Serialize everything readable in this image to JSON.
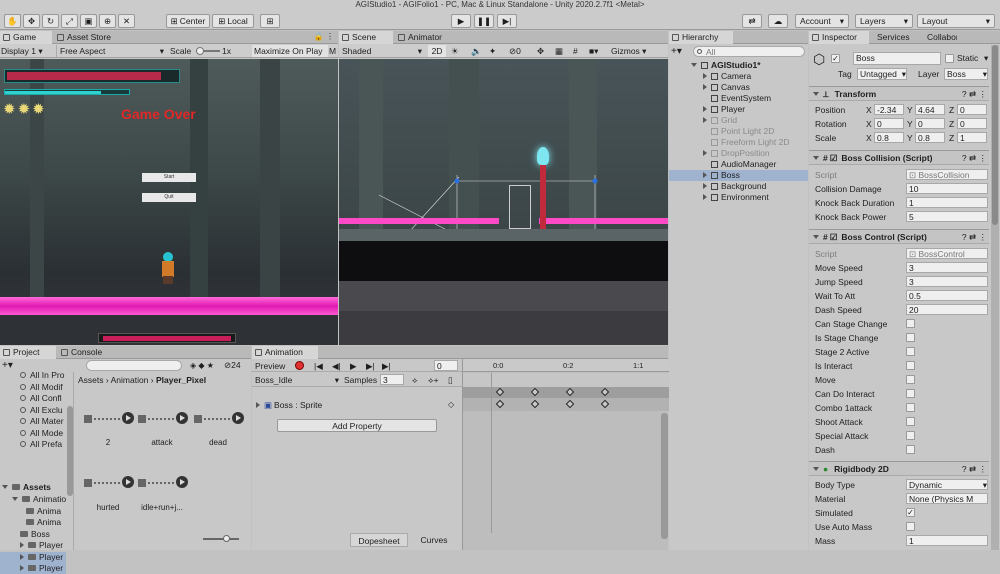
{
  "window_title": "AGIStudio1 - AGIFolio1 - PC, Mac & Linux Standalone - Unity 2020.2.7f1 <Metal>",
  "toolbar": {
    "center_label": "Center",
    "local_label": "Local",
    "account_label": "Account",
    "layers_label": "Layers",
    "layout_label": "Layout"
  },
  "game_panel": {
    "tab_game": "Game",
    "tab_asset_store": "Asset Store",
    "display": "Display 1",
    "aspect": "Free Aspect",
    "scale_label": "Scale",
    "scale_value": "1x",
    "maximize": "Maximize On Play",
    "mute": "M",
    "game_over": "Game Over",
    "start_btn": "Start",
    "quit_btn": "Quit"
  },
  "scene_panel": {
    "tab_scene": "Scene",
    "tab_animator": "Animator",
    "shading": "Shaded",
    "mode_2d": "2D",
    "gizmos": "Gizmos",
    "hidden_count": "0"
  },
  "hierarchy": {
    "tab": "Hierarchy",
    "search_placeholder": "All",
    "root": "AGIStudio1*",
    "items": [
      {
        "label": "Camera",
        "arrow": true,
        "dim": false
      },
      {
        "label": "Canvas",
        "arrow": true,
        "dim": false
      },
      {
        "label": "EventSystem",
        "arrow": false,
        "dim": false
      },
      {
        "label": "Player",
        "arrow": true,
        "dim": false
      },
      {
        "label": "Grid",
        "arrow": true,
        "dim": true
      },
      {
        "label": "Point Light 2D",
        "arrow": false,
        "dim": true
      },
      {
        "label": "Freeform Light 2D",
        "arrow": false,
        "dim": true
      },
      {
        "label": "DropPosition",
        "arrow": true,
        "dim": true
      },
      {
        "label": "AudioManager",
        "arrow": false,
        "dim": false
      },
      {
        "label": "Boss",
        "arrow": true,
        "dim": false
      },
      {
        "label": "Background",
        "arrow": true,
        "dim": false
      },
      {
        "label": "Environment",
        "arrow": true,
        "dim": false
      }
    ]
  },
  "inspector": {
    "tab_inspector": "Inspector",
    "tab_services": "Services",
    "tab_collab": "Collabor",
    "object_name": "Boss",
    "static_label": "Static",
    "tag_label": "Tag",
    "tag_value": "Untagged",
    "layer_label": "Layer",
    "layer_value": "Boss",
    "transform": {
      "title": "Transform",
      "position_label": "Position",
      "rotation_label": "Rotation",
      "scale_label": "Scale",
      "px": "-2.34",
      "py": "4.64",
      "pz": "0",
      "rx": "0",
      "ry": "0",
      "rz": "0",
      "sx": "0.8",
      "sy": "0.8",
      "sz": "1"
    },
    "boss_collision": {
      "title": "Boss Collision (Script)",
      "script_label": "Script",
      "script_value": "BossCollision",
      "fields": [
        {
          "label": "Collision Damage",
          "value": "10"
        },
        {
          "label": "Knock Back Duration",
          "value": "1"
        },
        {
          "label": "Knock Back Power",
          "value": "5"
        }
      ]
    },
    "boss_control": {
      "title": "Boss Control (Script)",
      "script_label": "Script",
      "script_value": "BossControl",
      "fields": [
        {
          "label": "Move Speed",
          "value": "3"
        },
        {
          "label": "Jump Speed",
          "value": "3"
        },
        {
          "label": "Wait To Att",
          "value": "0.5"
        },
        {
          "label": "Dash Speed",
          "value": "20"
        }
      ],
      "toggles": [
        "Can Stage Change",
        "Is Stage Change",
        "Stage 2 Active",
        "Is Interact",
        "Move",
        "Can Do Interact",
        "Combo 1attack",
        "Shoot Attack",
        "Special Attack",
        "Dash"
      ]
    },
    "rigidbody": {
      "title": "Rigidbody 2D",
      "body_type_label": "Body Type",
      "body_type": "Dynamic",
      "material_label": "Material",
      "material": "None (Physics M",
      "simulated_label": "Simulated",
      "auto_mass_label": "Use Auto Mass",
      "mass_label": "Mass",
      "mass": "1"
    }
  },
  "project": {
    "tab_project": "Project",
    "tab_console": "Console",
    "badge": "24",
    "breadcrumb_1": "Assets",
    "breadcrumb_2": "Animation",
    "breadcrumb_3": "Player_Pixel",
    "favorites": [
      "All In Pro",
      "All Modif",
      "All Confl",
      "All Exclu",
      "All Mater",
      "All Mode",
      "All Prefa"
    ],
    "assets_root": "Assets",
    "tree": [
      "Animatio",
      "Anima",
      "Anima",
      "Boss",
      "Player",
      "Player",
      "Player"
    ],
    "animations": [
      "2",
      "attack",
      "dead",
      "hurted",
      "idle+run+j..."
    ]
  },
  "animation": {
    "tab": "Animation",
    "preview": "Preview",
    "frame": "0",
    "clip": "Boss_Idle",
    "samples_label": "Samples",
    "samples": "3",
    "property": "Boss : Sprite",
    "add_property": "Add Property",
    "dopesheet": "Dopesheet",
    "curves": "Curves",
    "ticks": [
      "0:0",
      "0:2",
      "1:1"
    ]
  }
}
